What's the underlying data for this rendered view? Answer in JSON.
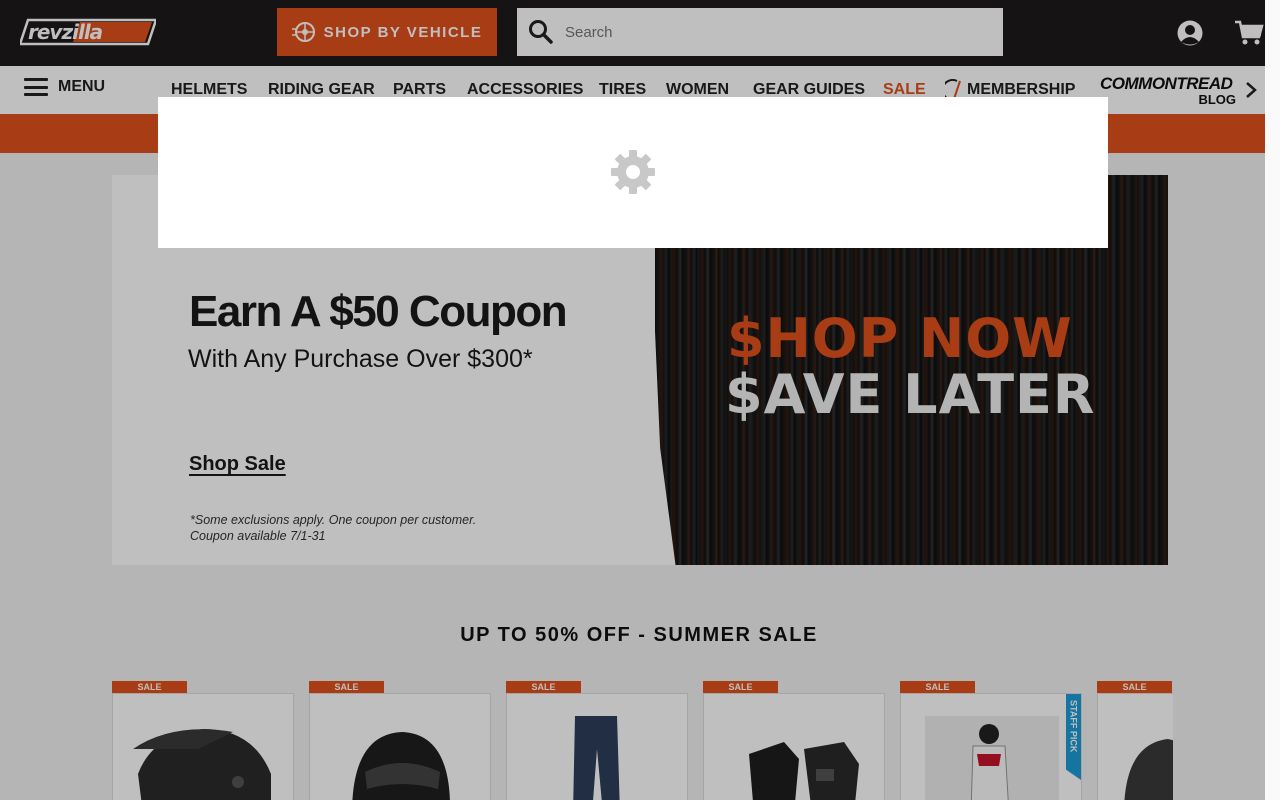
{
  "header": {
    "logo_text": "revzilla",
    "shop_by_vehicle": "SHOP BY VEHICLE",
    "search_placeholder": "Search",
    "icons": [
      "search-icon",
      "user-icon",
      "cart-icon",
      "wheel-icon"
    ]
  },
  "nav": {
    "menu_label": "MENU",
    "items": [
      "HELMETS",
      "RIDING GEAR",
      "PARTS",
      "ACCESSORIES",
      "TIRES",
      "WOMEN",
      "GEAR GUIDES",
      "SALE",
      "MEMBERSHIP"
    ],
    "commontread_top": "COMMONTREAD",
    "commontread_bottom": "BLOG"
  },
  "banner": {
    "headline": "Earn A $50 Coupon",
    "subline": "With Any Purchase Over $300*",
    "link": "Shop Sale",
    "fine_print_1": "*Some exclusions apply. One coupon per customer.",
    "fine_print_2": "Coupon available 7/1-31",
    "shop_now": "$HOP NOW",
    "save_later": "$AVE LATER"
  },
  "section": {
    "title": "UP TO 50% OFF - SUMMER SALE",
    "sale_tag": "SALE",
    "staff_pick": "STAFF PICK"
  },
  "colors": {
    "brand_orange": "#e0521d",
    "header_dark": "#1c1a1a",
    "staff_pick_blue": "#1e9bd7"
  }
}
